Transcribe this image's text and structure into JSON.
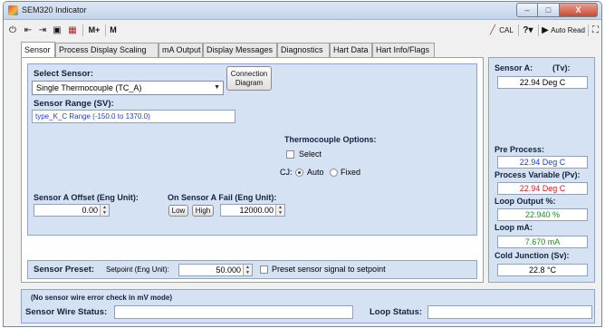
{
  "window": {
    "title": "SEM320 Indicator",
    "min_glyph": "–",
    "max_glyph": "□",
    "close_glyph": "X"
  },
  "toolbar": {
    "power_icon": "⏻",
    "connect_icon": "⇤",
    "connect2_icon": "⇥",
    "save_icon": "▣",
    "device_icon": "▦",
    "mplus_label": "M+",
    "m_label": "M",
    "cal_label": "CAL",
    "help_label": "?▾",
    "auto_read_label": "Auto Read",
    "network_icon": "⛶"
  },
  "tabs": [
    "Sensor",
    "Process Display Scaling",
    "mA Output",
    "Display Messages",
    "Diagnostics",
    "Hart Data",
    "Hart Info/Flags"
  ],
  "sensor": {
    "select_label": "Select Sensor:",
    "selected_sensor": "Single Thermocouple (TC_A)",
    "connection_button": "Connection Diagram",
    "range_label": "Sensor Range (SV):",
    "range_value": "type_K_C Range (-150.0 to 1370.0)",
    "tc_options_label": "Thermocouple Options:",
    "select_checkbox_label": "Select",
    "cj_label": "CJ:",
    "cj_auto": "Auto",
    "cj_fixed": "Fixed",
    "offset_label": "Sensor A Offset (Eng Unit):",
    "offset_value": "0.00",
    "fail_label": "On Sensor A Fail (Eng Unit):",
    "fail_low": "Low",
    "fail_high": "High",
    "fail_value": "12000.00",
    "preset_label": "Sensor Preset:",
    "setpoint_label": "Setpoint (Eng Unit):",
    "setpoint_value": "50.000",
    "preset_checkbox_label": "Preset sensor signal to setpoint"
  },
  "readings": {
    "sensor_a_label": "Sensor A:",
    "sensor_a_tv": "(Tv):",
    "sensor_a_value": "22.94 Deg C",
    "pre_process_label": "Pre Process:",
    "pre_process_value": "22.94 Deg C",
    "pv_label": "Process Variable (Pv):",
    "pv_value": "22.94 Deg C",
    "loop_output_label": "Loop Output %:",
    "loop_output_value": "22.940 %",
    "loop_ma_label": "Loop mA:",
    "loop_ma_value": "7.670 mA",
    "cj_label": "Cold Junction (Sv):",
    "cj_value": "22.8 °C"
  },
  "status": {
    "note": "(No sensor wire error check in mV mode)",
    "wire_label": "Sensor Wire Status:",
    "wire_value": "",
    "loop_label": "Loop Status:",
    "loop_value": ""
  },
  "colors": {
    "panel_blue": "#d4e2f4",
    "value_blue": "#1f3fbf",
    "value_red": "#d42020",
    "value_green": "#1f8a1f"
  }
}
